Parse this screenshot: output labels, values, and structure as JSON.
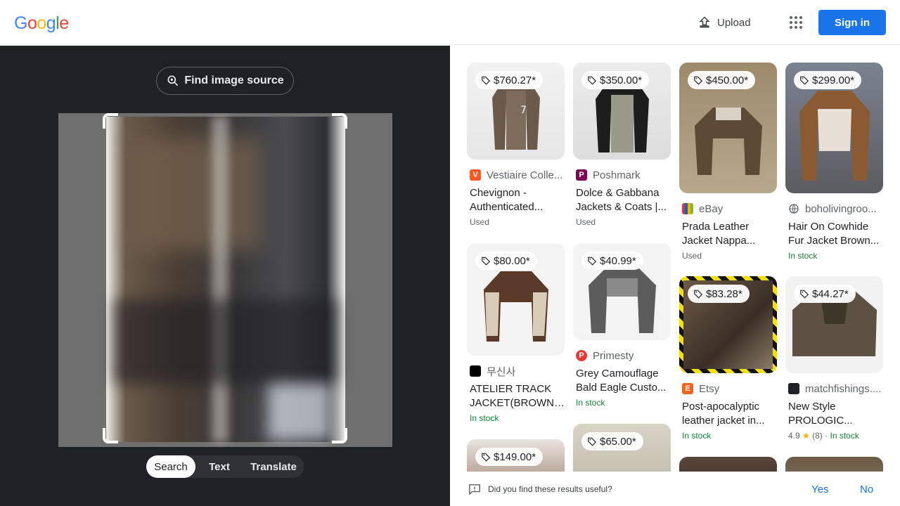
{
  "header": {
    "logo_letters": [
      "G",
      "o",
      "o",
      "g",
      "l",
      "e"
    ],
    "logo_colors": [
      "#4285F4",
      "#EA4335",
      "#FBBC05",
      "#4285F4",
      "#34A853",
      "#EA4335"
    ],
    "upload_label": "Upload",
    "apps_icon": "apps-grid-icon",
    "signin_label": "Sign in",
    "accent": "#1a73e8"
  },
  "left": {
    "find_source_label": "Find image source",
    "modes": [
      "Search",
      "Text",
      "Translate"
    ],
    "active_mode": "Search"
  },
  "results": [
    {
      "price": "$760.27*",
      "site": "Vestiaire Colle...",
      "favicon_letter": "V",
      "favicon_color": "#ff5722",
      "title1": "Chevignon -",
      "title2": "Authenticated...",
      "status": "Used",
      "status_type": "used"
    },
    {
      "price": "$350.00*",
      "site": "Poshmark",
      "favicon_letter": "P",
      "favicon_color": "#7f0353",
      "title1": "Dolce & Gabbana",
      "title2": "Jackets & Coats |...",
      "status": "Used",
      "status_type": "used"
    },
    {
      "price": "$450.00*",
      "site": "eBay",
      "favicon_letter": "e",
      "favicon_color": "#e53238",
      "title1": "Prada Leather",
      "title2": "Jacket Nappa...",
      "status": "Used",
      "status_type": "used"
    },
    {
      "price": "$299.00*",
      "site": "boholivingroo...",
      "favicon_letter": "",
      "favicon_color": "#5f6368",
      "title1": "Hair On Cowhide",
      "title2": "Fur Jacket Brown...",
      "status": "In stock",
      "status_type": "instock"
    },
    {
      "price": "$80.00*",
      "site": "무신사",
      "favicon_letter": "",
      "favicon_color": "#000000",
      "title1": "ATELIER TRACK",
      "title2": "JACKET(BROWN)...",
      "status": "In stock",
      "status_type": "instock"
    },
    {
      "price": "$40.99*",
      "site": "Primesty",
      "favicon_letter": "P",
      "favicon_color": "#e53935",
      "title1": "Grey Camouflage",
      "title2": "Bald Eagle Custo...",
      "status": "In stock",
      "status_type": "instock"
    },
    {
      "price": "$83.28*",
      "site": "Etsy",
      "favicon_letter": "E",
      "favicon_color": "#f1641e",
      "title1": "Post-apocalyptic",
      "title2": "leather jacket in...",
      "status": "In stock",
      "status_type": "instock"
    },
    {
      "price": "$44.27*",
      "site": "matchfishings....",
      "favicon_letter": "",
      "favicon_color": "#202124",
      "title1": "New Style",
      "title2": "PROLOGIC...",
      "status": "In stock",
      "status_type": "instock",
      "rating": "4.9",
      "reviews": "(8)"
    },
    {
      "price": "$149.00*"
    },
    {
      "price": "$65.00*"
    }
  ],
  "feedback": {
    "question": "Did you find these results useful?",
    "yes": "Yes",
    "no": "No"
  }
}
